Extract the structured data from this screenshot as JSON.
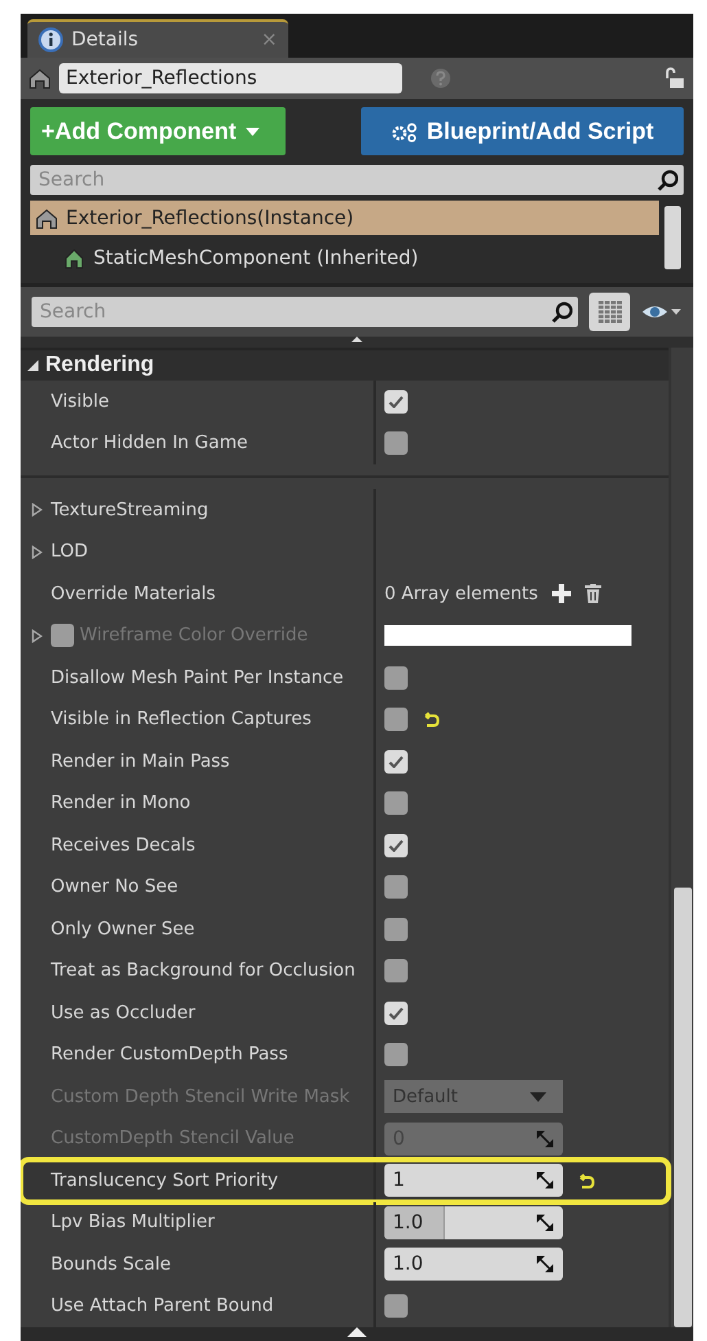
{
  "tab": {
    "title": "Details",
    "close": "×"
  },
  "actor_name": {
    "value": "Exterior_Reflections"
  },
  "buttons": [
    {
      "kind": "add",
      "label": "+Add Component"
    },
    {
      "kind": "blueprint",
      "label": "Blueprint/Add Script"
    }
  ],
  "component_search": {
    "placeholder": "Search"
  },
  "components": [
    {
      "label": "Exterior_Reflections(Instance)",
      "selected": true,
      "children": [
        {
          "label": "StaticMeshComponent (Inherited)",
          "selected": false
        }
      ]
    }
  ],
  "details_search": {
    "placeholder": "Search"
  },
  "category": {
    "title": "Rendering",
    "expanded": true,
    "groups": [
      [
        {
          "kind": "checkbox",
          "label": "Visible",
          "checked": true,
          "disabled": false,
          "modified": false,
          "highlighted": false
        },
        {
          "kind": "checkbox",
          "label": "Actor Hidden In Game",
          "checked": false,
          "disabled": false,
          "modified": false,
          "highlighted": false
        }
      ],
      [
        {
          "kind": "group",
          "label": "TextureStreaming",
          "expanded": false,
          "disabled": false,
          "modified": false,
          "highlighted": false
        },
        {
          "kind": "group",
          "label": "LOD",
          "expanded": false,
          "disabled": false,
          "modified": false,
          "highlighted": false
        },
        {
          "kind": "array",
          "label": "Override Materials",
          "value": "0 Array elements",
          "disabled": false,
          "modified": false,
          "highlighted": false
        },
        {
          "kind": "color",
          "label": "Wireframe Color Override",
          "expanded": false,
          "checked": false,
          "color": "#ffffff",
          "disabled": true,
          "modified": false,
          "highlighted": false
        },
        {
          "kind": "checkbox",
          "label": "Disallow Mesh Paint Per Instance",
          "checked": false,
          "disabled": false,
          "modified": false,
          "highlighted": false
        },
        {
          "kind": "checkbox",
          "label": "Visible in Reflection Captures",
          "checked": false,
          "disabled": false,
          "modified": true,
          "highlighted": false
        },
        {
          "kind": "checkbox",
          "label": "Render in Main Pass",
          "checked": true,
          "disabled": false,
          "modified": false,
          "highlighted": false
        },
        {
          "kind": "checkbox",
          "label": "Render in Mono",
          "checked": false,
          "disabled": false,
          "modified": false,
          "highlighted": false
        },
        {
          "kind": "checkbox",
          "label": "Receives Decals",
          "checked": true,
          "disabled": false,
          "modified": false,
          "highlighted": false
        },
        {
          "kind": "checkbox",
          "label": "Owner No See",
          "checked": false,
          "disabled": false,
          "modified": false,
          "highlighted": false
        },
        {
          "kind": "checkbox",
          "label": "Only Owner See",
          "checked": false,
          "disabled": false,
          "modified": false,
          "highlighted": false
        },
        {
          "kind": "checkbox",
          "label": "Treat as Background for Occlusion",
          "checked": false,
          "disabled": false,
          "modified": false,
          "highlighted": false
        },
        {
          "kind": "checkbox",
          "label": "Use as Occluder",
          "checked": true,
          "disabled": false,
          "modified": false,
          "highlighted": false
        },
        {
          "kind": "checkbox",
          "label": "Render CustomDepth Pass",
          "checked": false,
          "disabled": false,
          "modified": false,
          "highlighted": false
        },
        {
          "kind": "dropdown",
          "label": "Custom Depth Stencil Write Mask",
          "value": "Default",
          "disabled": true,
          "modified": false,
          "highlighted": false
        },
        {
          "kind": "number",
          "label": "CustomDepth Stencil Value",
          "value": "0",
          "disabled": true,
          "modified": false,
          "highlighted": false
        },
        {
          "kind": "number",
          "label": "Translucency Sort Priority",
          "value": "1",
          "disabled": false,
          "modified": true,
          "highlighted": true
        },
        {
          "kind": "number",
          "label": "Lpv Bias Multiplier",
          "value": "1.0",
          "level": 0.33,
          "disabled": false,
          "modified": false,
          "highlighted": false
        },
        {
          "kind": "number",
          "label": "Bounds Scale",
          "value": "1.0",
          "disabled": false,
          "modified": false,
          "highlighted": false
        },
        {
          "kind": "checkbox",
          "label": "Use Attach Parent Bound",
          "checked": false,
          "disabled": false,
          "modified": false,
          "highlighted": false
        }
      ]
    ]
  }
}
